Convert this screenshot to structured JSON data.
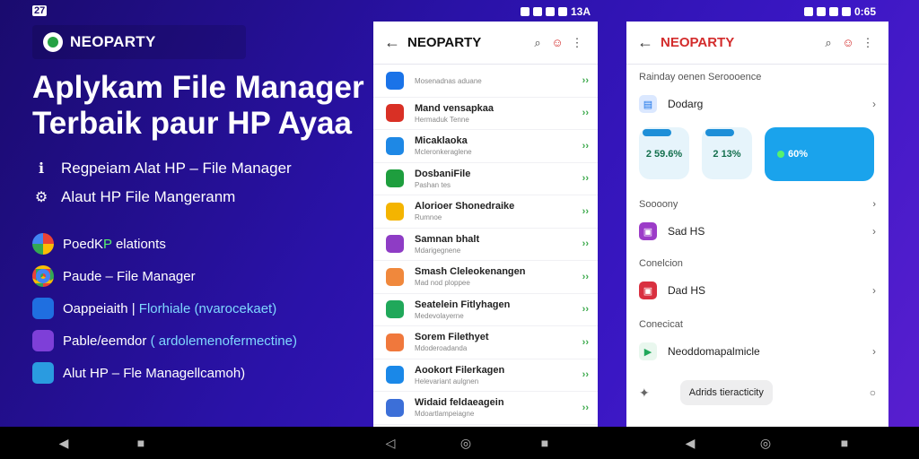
{
  "status": {
    "left_badge": "27",
    "time_phone1": "13A",
    "time_phone2": "0:65"
  },
  "hero": {
    "brand": "NEOPARTY",
    "headline_line1": "Aplykam File Manager",
    "headline_line2": "Terbaik paur HP Ayaa",
    "features": [
      {
        "icon": "info-icon",
        "text": "Regpeiam Alat HP – File Manager"
      },
      {
        "icon": "settings-icon",
        "text": "Alaut HP File Mangeranm"
      }
    ],
    "apps": [
      {
        "icon": "google-icon",
        "color": "#ea4335",
        "prefix": "PoedK",
        "accent": "P",
        "suffix": " elationts"
      },
      {
        "icon": "chrome-icon",
        "color": "#4285f4",
        "prefix": "Paude – File Manager",
        "accent": "",
        "suffix": ""
      },
      {
        "icon": "app-icon",
        "color": "#1f6fe0",
        "prefix": "Oappeiaith | ",
        "accent": "Florhiale (nvarocekaet)",
        "suffix": ""
      },
      {
        "icon": "app-icon",
        "color": "#7e3fd8",
        "prefix": "Pable/eemdor ",
        "accent": "( ardolemenofermectine)",
        "suffix": ""
      },
      {
        "icon": "file-icon",
        "color": "#2a9be0",
        "prefix": "Alut HP – Fle Managellcamoh)",
        "accent": "",
        "suffix": ""
      }
    ]
  },
  "phone1": {
    "title": "NEOPARTY",
    "rows": [
      {
        "title": "",
        "sub": "Mosenadnas aduane",
        "color": "#1a73e8"
      },
      {
        "title": "Mand vensapkaa",
        "sub": "Hermaduk Tenne",
        "color": "#d93025"
      },
      {
        "title": "Micaklaoka",
        "sub": "Mcleronkeraglene",
        "color": "#1e88e5"
      },
      {
        "title": "DosbaniFile",
        "sub": "Pashan tes",
        "color": "#1e9e3e"
      },
      {
        "title": "Alorioer Shonedraike",
        "sub": "Rumnoe",
        "color": "#f4b400"
      },
      {
        "title": "Samnan bhalt",
        "sub": "Mdarigegnene",
        "color": "#8e3cc5"
      },
      {
        "title": "Smash Cleleokenangen",
        "sub": "Mad nod ploppee",
        "color": "#f0883c"
      },
      {
        "title": "Seatelein Fitlyhagen",
        "sub": "Medevolayerne",
        "color": "#20a85a"
      },
      {
        "title": "Sorem Filethyet",
        "sub": "Mdoderoadanda",
        "color": "#f0783c"
      },
      {
        "title": "Aookort Filerkagen",
        "sub": "Helevariant aulgnen",
        "color": "#1a88e8"
      },
      {
        "title": "Widaid feldaeagein",
        "sub": "Mdoartlampeiagne",
        "color": "#3c6fd8"
      }
    ]
  },
  "phone2": {
    "title": "NEOPARTY",
    "section_top": "Rainday oenen Seroooence",
    "row_top": "Dodarg",
    "cards": [
      {
        "value": "2 59.6%"
      },
      {
        "value": "2 13%"
      },
      {
        "value": "60%"
      }
    ],
    "section1": "Soooony",
    "row1": "Sad HS",
    "section2": "Conelcion",
    "row2": "Dad HS",
    "section3": "Conecicat",
    "row3": "Neoddomapalmicle",
    "pill": "Adrids tieracticity"
  }
}
